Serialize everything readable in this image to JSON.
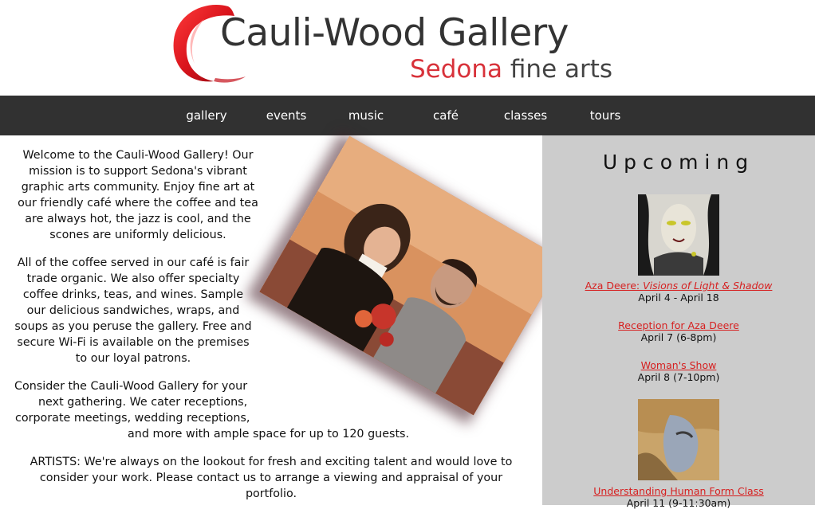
{
  "header": {
    "logo_title": "Cauli-Wood Gallery",
    "logo_sub_red": "Sedona",
    "logo_sub_dark": "fine arts",
    "brand_red": "#d8323a"
  },
  "nav": {
    "items": [
      "gallery",
      "events",
      "music",
      "café",
      "classes",
      "tours"
    ],
    "background": "#313131"
  },
  "main": {
    "para1_lines": [
      "Welcome to the Cauli-Wood Gallery! Our",
      "mission is to support Sedona's vibrant",
      "graphic arts community. Enjoy fine art at",
      "our friendly café where the coffee and tea",
      "are always hot, the jazz is cool, and the",
      "scones are uniformly delicious."
    ],
    "para2_lines": [
      "All of the coffee served in our café is fair",
      "trade organic. We also offer specialty",
      "coffee drinks, teas, and wines. Sample",
      "our delicious sandwiches, wraps, and",
      "soups as you peruse the gallery. Free and",
      "secure Wi-Fi is available on the premises",
      "to our loyal patrons."
    ],
    "para3_lines": [
      "Consider the Cauli-Wood Gallery for your",
      "next gathering. We cater receptions,",
      "corporate meetings, wedding receptions,",
      "and more with ample space for up to 120 guests."
    ],
    "para4_lines": [
      "ARTISTS: We're always on the lookout for fresh and exciting talent and would love to",
      "consider your work. Please contact us to arrange a viewing and appraisal of your",
      "portfolio."
    ]
  },
  "sidebar": {
    "title": "Upcoming",
    "events": [
      {
        "link_prefix": "Aza Deere: ",
        "link_italic": "Visions of Light & Shadow",
        "date": "April 4 - April 18"
      },
      {
        "link_prefix": "Reception for Aza Deere",
        "link_italic": "",
        "date": "April 7 (6-8pm)"
      },
      {
        "link_prefix": "Woman's Show",
        "link_italic": "",
        "date": "April 8 (7-10pm)"
      },
      {
        "link_prefix": "Understanding Human Form Class",
        "link_italic": "",
        "date": "April 11 (9-11:30am)"
      }
    ],
    "link_color": "#d62020",
    "background": "#cccccc"
  }
}
